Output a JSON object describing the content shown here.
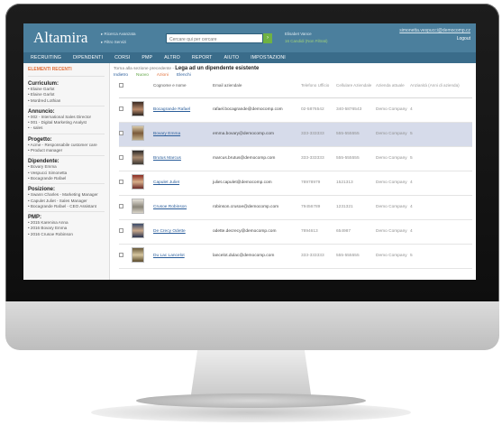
{
  "header": {
    "logo": "Altamira",
    "links": [
      "Ricerca Avanzata",
      "Filtro Servizi"
    ],
    "search_placeholder": "Cercare qui per cercare",
    "search_button": "›",
    "user_name": "Elisabet Vance",
    "user_location": "16 Candidi (Non Filtrati)",
    "email": "simonetta.vespucci@democomp.cz",
    "logout": "Logout"
  },
  "nav": {
    "items": [
      "RECRUITING",
      "DIPENDENTI",
      "CORSI",
      "PMP",
      "ALTRO",
      "REPORT",
      "AIUTO",
      "IMPOSTAZIONI"
    ]
  },
  "sidebar": {
    "title": "ELEMENTI RECENTI",
    "sections": [
      {
        "heading": "Curriculum:",
        "items": [
          "Elaine Garlot",
          "Elaine Garlot",
          "Mordred Lothian"
        ]
      },
      {
        "heading": "Annuncio:",
        "items": [
          "002 - International Sales Director",
          "001 - Digital Marketing Analyst",
          "- sales"
        ]
      },
      {
        "heading": "Progetto:",
        "items": [
          "Acme - Responsabile customer care",
          "Product manager"
        ]
      },
      {
        "heading": "Dipendente:",
        "items": [
          "Bovary Emma",
          "Vespucci Simonetta",
          "Bocagrande Rafael"
        ]
      },
      {
        "heading": "Posizione:",
        "items": [
          "Swann Charles - Marketing Manager",
          "Capulet Juliet - Sales Manager",
          "Bocagrande Rafael - CEO Assistant"
        ]
      },
      {
        "heading": "PMP:",
        "items": [
          "2015 Karenina Anna",
          "2016 Bovary Emma",
          "2016 Crusoe Robinson"
        ]
      }
    ]
  },
  "main": {
    "crumb_prefix": "Torna alla sezione precedente - ",
    "crumb_title": "Lega ad un dipendente esistente",
    "actions": {
      "back": "Indietro",
      "new": "Nuovo",
      "edit": "Azioni",
      "list": "Elenchi"
    },
    "columns": [
      "Cognome e nome",
      "Email aziendale",
      "Telefono Ufficio",
      "Cellulare Aziendale",
      "Azienda attuale",
      "Anzianità (Anni di azienda)"
    ],
    "rows": [
      {
        "name": "Bocagrande Rafael",
        "email": "rafael.bocagrande@democomp.com",
        "phone": "02-5876542",
        "mobile": "340-5876543",
        "company": "Demo Company",
        "years": "4"
      },
      {
        "name": "Bovary Emma",
        "email": "emma.bovary@democomp.com",
        "phone": "333-333333",
        "mobile": "555-555555",
        "company": "Demo Company",
        "years": "5"
      },
      {
        "name": "Brutus Marcus",
        "email": "marcus.brutus@democomp.com",
        "phone": "333-333333",
        "mobile": "555-555555",
        "company": "Demo Company",
        "years": "5"
      },
      {
        "name": "Capulet Juliet",
        "email": "juliet.capulet@democomp.com",
        "phone": "78978979",
        "mobile": "1521313",
        "company": "Demo Company",
        "years": "4"
      },
      {
        "name": "Crusoe Robinson",
        "email": "robinson.crusoe@democomp.com",
        "phone": "79456789",
        "mobile": "1231321",
        "company": "Demo Company",
        "years": "4"
      },
      {
        "name": "De Crecy Odette",
        "email": "odette.decrecy@democomp.com",
        "phone": "7894613",
        "mobile": "654987",
        "company": "Demo Company",
        "years": "4"
      },
      {
        "name": "Du Lac Lancelot",
        "email": "lancelot.dulac@democomp.com",
        "phone": "333-333333",
        "mobile": "555-555555",
        "company": "Demo Company",
        "years": "5"
      }
    ]
  },
  "colors": {
    "header": "#4b7f9d",
    "nav": "#3a6c8a",
    "accent_orange": "#e2703a",
    "accent_green": "#6fb243",
    "selected_row": "#d6dbea"
  }
}
